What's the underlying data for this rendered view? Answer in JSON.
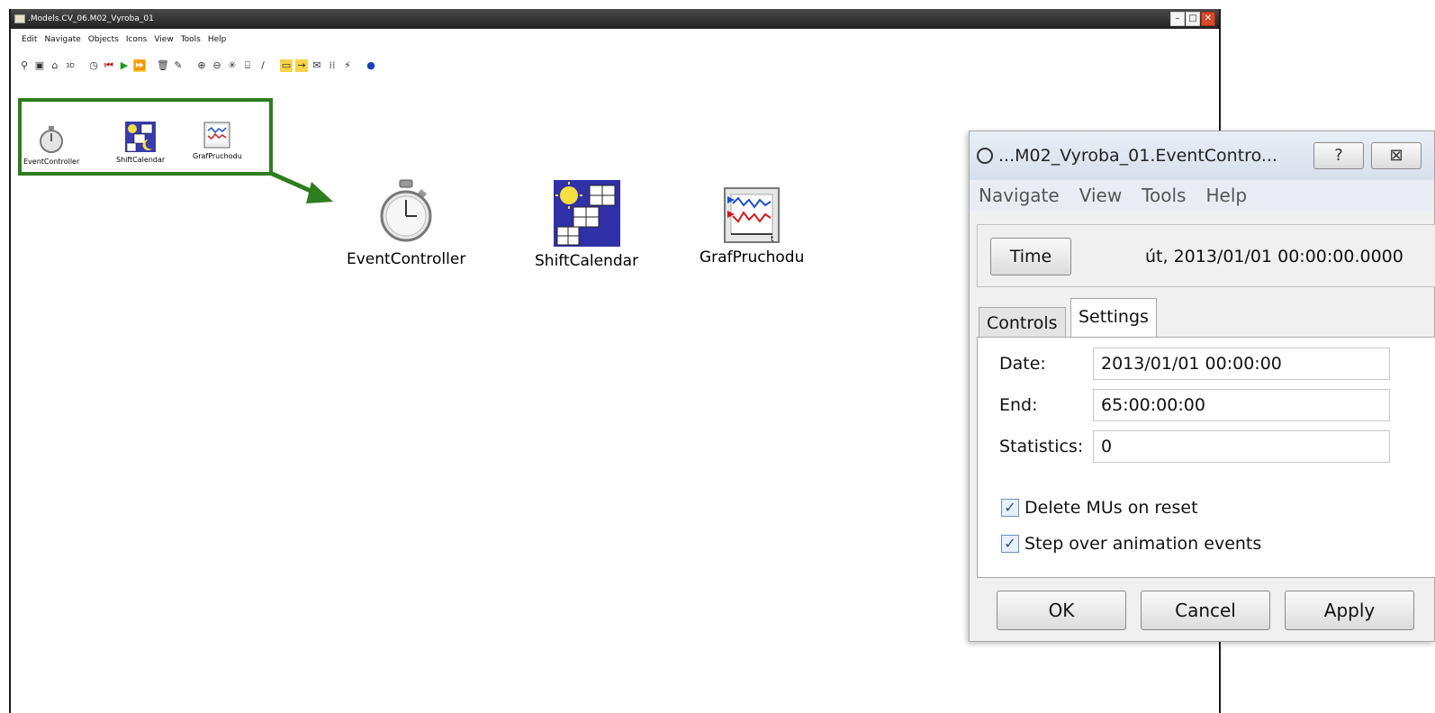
{
  "main_window": {
    "title": ".Models.CV_06.M02_Vyroba_01",
    "menu": [
      "Edit",
      "Navigate",
      "Objects",
      "Icons",
      "View",
      "Tools",
      "Help"
    ],
    "toolbar_icons": [
      "binoculars-icon",
      "frame-icon",
      "home-icon",
      "3d-icon",
      "stopwatch-icon",
      "reset-icon",
      "start-icon",
      "fast-forward-icon",
      "delete-icon",
      "paint-icon",
      "zoom-in-icon",
      "zoom-out-icon",
      "select-icon",
      "frame-icon",
      "edit-icon",
      "connector-icon",
      "arrow-icon",
      "comment-icon",
      "grid-icon",
      "chart-icon",
      "help-icon"
    ]
  },
  "small_objects": [
    {
      "label": "EventController",
      "icon": "stopwatch-icon"
    },
    {
      "label": "ShiftCalendar",
      "icon": "calendar-icon"
    },
    {
      "label": "GrafPruchodu",
      "icon": "chart-icon"
    }
  ],
  "big_objects": [
    {
      "label": "EventController",
      "icon": "stopwatch-icon"
    },
    {
      "label": "ShiftCalendar",
      "icon": "calendar-icon"
    },
    {
      "label": "GrafPruchodu",
      "icon": "chart-icon"
    }
  ],
  "dialog": {
    "title": "...M02_Vyroba_01.EventContro...",
    "help_button": "?",
    "close_button": "⊠",
    "menu": [
      "Navigate",
      "View",
      "Tools",
      "Help"
    ],
    "time_button": "Time",
    "time_value": "út, 2013/01/01 00:00:00.0000",
    "tabs": [
      "Controls",
      "Settings"
    ],
    "active_tab": "Settings",
    "fields": {
      "date_label": "Date:",
      "date_value": "2013/01/01 00:00:00",
      "end_label": "End:",
      "end_value": "65:00:00:00",
      "statistics_label": "Statistics:",
      "statistics_value": "0"
    },
    "checkboxes": {
      "delete_mus_label": "Delete MUs on reset",
      "delete_mus_checked": true,
      "step_over_label": "Step over animation events",
      "step_over_checked": true
    },
    "buttons": {
      "ok": "OK",
      "cancel": "Cancel",
      "apply": "Apply"
    }
  },
  "colors": {
    "highlight_green": "#2e7d1e",
    "titlebar_dark": "#2a2a2a"
  }
}
